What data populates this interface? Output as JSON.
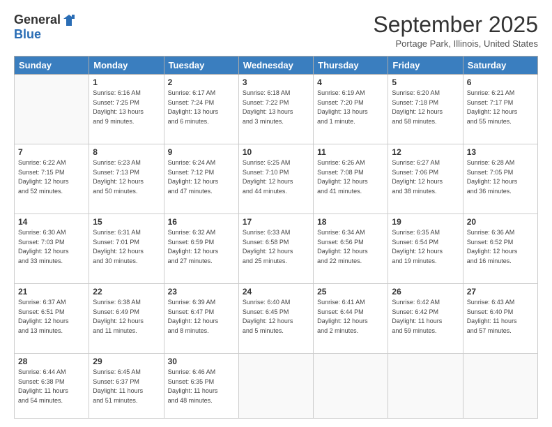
{
  "logo": {
    "general": "General",
    "blue": "Blue"
  },
  "title": "September 2025",
  "location": "Portage Park, Illinois, United States",
  "days_of_week": [
    "Sunday",
    "Monday",
    "Tuesday",
    "Wednesday",
    "Thursday",
    "Friday",
    "Saturday"
  ],
  "weeks": [
    [
      {
        "day": "",
        "info": ""
      },
      {
        "day": "1",
        "info": "Sunrise: 6:16 AM\nSunset: 7:25 PM\nDaylight: 13 hours\nand 9 minutes."
      },
      {
        "day": "2",
        "info": "Sunrise: 6:17 AM\nSunset: 7:24 PM\nDaylight: 13 hours\nand 6 minutes."
      },
      {
        "day": "3",
        "info": "Sunrise: 6:18 AM\nSunset: 7:22 PM\nDaylight: 13 hours\nand 3 minutes."
      },
      {
        "day": "4",
        "info": "Sunrise: 6:19 AM\nSunset: 7:20 PM\nDaylight: 13 hours\nand 1 minute."
      },
      {
        "day": "5",
        "info": "Sunrise: 6:20 AM\nSunset: 7:18 PM\nDaylight: 12 hours\nand 58 minutes."
      },
      {
        "day": "6",
        "info": "Sunrise: 6:21 AM\nSunset: 7:17 PM\nDaylight: 12 hours\nand 55 minutes."
      }
    ],
    [
      {
        "day": "7",
        "info": "Sunrise: 6:22 AM\nSunset: 7:15 PM\nDaylight: 12 hours\nand 52 minutes."
      },
      {
        "day": "8",
        "info": "Sunrise: 6:23 AM\nSunset: 7:13 PM\nDaylight: 12 hours\nand 50 minutes."
      },
      {
        "day": "9",
        "info": "Sunrise: 6:24 AM\nSunset: 7:12 PM\nDaylight: 12 hours\nand 47 minutes."
      },
      {
        "day": "10",
        "info": "Sunrise: 6:25 AM\nSunset: 7:10 PM\nDaylight: 12 hours\nand 44 minutes."
      },
      {
        "day": "11",
        "info": "Sunrise: 6:26 AM\nSunset: 7:08 PM\nDaylight: 12 hours\nand 41 minutes."
      },
      {
        "day": "12",
        "info": "Sunrise: 6:27 AM\nSunset: 7:06 PM\nDaylight: 12 hours\nand 38 minutes."
      },
      {
        "day": "13",
        "info": "Sunrise: 6:28 AM\nSunset: 7:05 PM\nDaylight: 12 hours\nand 36 minutes."
      }
    ],
    [
      {
        "day": "14",
        "info": "Sunrise: 6:30 AM\nSunset: 7:03 PM\nDaylight: 12 hours\nand 33 minutes."
      },
      {
        "day": "15",
        "info": "Sunrise: 6:31 AM\nSunset: 7:01 PM\nDaylight: 12 hours\nand 30 minutes."
      },
      {
        "day": "16",
        "info": "Sunrise: 6:32 AM\nSunset: 6:59 PM\nDaylight: 12 hours\nand 27 minutes."
      },
      {
        "day": "17",
        "info": "Sunrise: 6:33 AM\nSunset: 6:58 PM\nDaylight: 12 hours\nand 25 minutes."
      },
      {
        "day": "18",
        "info": "Sunrise: 6:34 AM\nSunset: 6:56 PM\nDaylight: 12 hours\nand 22 minutes."
      },
      {
        "day": "19",
        "info": "Sunrise: 6:35 AM\nSunset: 6:54 PM\nDaylight: 12 hours\nand 19 minutes."
      },
      {
        "day": "20",
        "info": "Sunrise: 6:36 AM\nSunset: 6:52 PM\nDaylight: 12 hours\nand 16 minutes."
      }
    ],
    [
      {
        "day": "21",
        "info": "Sunrise: 6:37 AM\nSunset: 6:51 PM\nDaylight: 12 hours\nand 13 minutes."
      },
      {
        "day": "22",
        "info": "Sunrise: 6:38 AM\nSunset: 6:49 PM\nDaylight: 12 hours\nand 11 minutes."
      },
      {
        "day": "23",
        "info": "Sunrise: 6:39 AM\nSunset: 6:47 PM\nDaylight: 12 hours\nand 8 minutes."
      },
      {
        "day": "24",
        "info": "Sunrise: 6:40 AM\nSunset: 6:45 PM\nDaylight: 12 hours\nand 5 minutes."
      },
      {
        "day": "25",
        "info": "Sunrise: 6:41 AM\nSunset: 6:44 PM\nDaylight: 12 hours\nand 2 minutes."
      },
      {
        "day": "26",
        "info": "Sunrise: 6:42 AM\nSunset: 6:42 PM\nDaylight: 11 hours\nand 59 minutes."
      },
      {
        "day": "27",
        "info": "Sunrise: 6:43 AM\nSunset: 6:40 PM\nDaylight: 11 hours\nand 57 minutes."
      }
    ],
    [
      {
        "day": "28",
        "info": "Sunrise: 6:44 AM\nSunset: 6:38 PM\nDaylight: 11 hours\nand 54 minutes."
      },
      {
        "day": "29",
        "info": "Sunrise: 6:45 AM\nSunset: 6:37 PM\nDaylight: 11 hours\nand 51 minutes."
      },
      {
        "day": "30",
        "info": "Sunrise: 6:46 AM\nSunset: 6:35 PM\nDaylight: 11 hours\nand 48 minutes."
      },
      {
        "day": "",
        "info": ""
      },
      {
        "day": "",
        "info": ""
      },
      {
        "day": "",
        "info": ""
      },
      {
        "day": "",
        "info": ""
      }
    ]
  ]
}
